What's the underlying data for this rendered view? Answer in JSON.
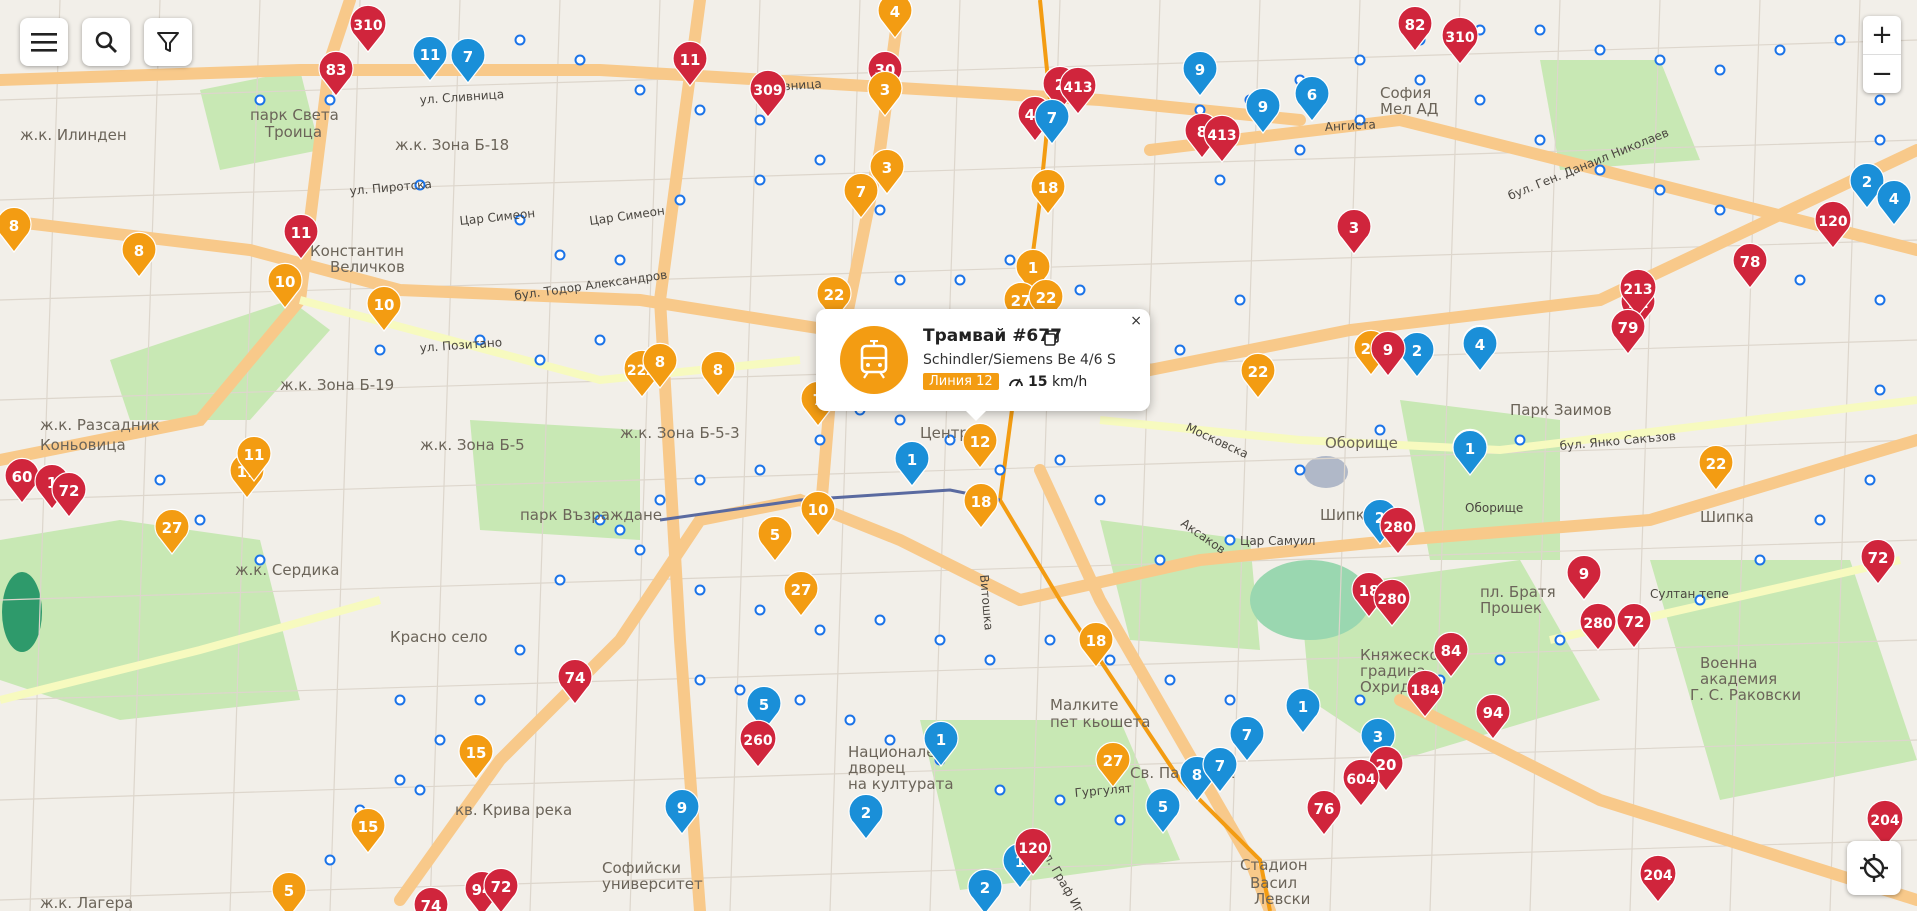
{
  "controls": {
    "menu_icon": "menu-icon",
    "search_icon": "search-icon",
    "filter_icon": "filter-icon",
    "zoom_in": "+",
    "zoom_out": "−",
    "locate_icon": "locate-icon"
  },
  "colors": {
    "tram": "#f39c12",
    "bus": "#d0253c",
    "trolley": "#1a8fd8",
    "stop": "#1a73e8"
  },
  "popup": {
    "title": "Трамвай #677",
    "model": "Schindler/Siemens Be 4/6 S",
    "line": "Линия 12",
    "speed_value": "15",
    "speed_unit": "km/h",
    "close": "×"
  },
  "place_labels": [
    "ж.к. Илинден",
    "ж.к. Зона Б-18",
    "ж.к. Зона Б-19",
    "ж.к. Разсадник",
    "Коньовица",
    "ж.к. Зона Б-5",
    "ж.к. Зона Б-5-3",
    "ж.к. Сердика",
    "кв. Крива река",
    "парк Света",
    "Троица",
    "парк Възраждане",
    "Центр",
    "Малките",
    "пет кьошета",
    "Княжеско",
    "градина",
    "Охридско",
    "пл. Братя",
    "Прошек",
    "Военна",
    "академия",
    "Г. С. Раковски",
    "Парк Заимов",
    "Константин",
    "Величков",
    "Стадион",
    "Васил",
    "Левски",
    "Софийски",
    "университет",
    "Национален",
    "дворец",
    "на културата",
    "Св. Патриарх",
    "ж.к. Лагера",
    "Красно село",
    "Oборище",
    "Шипка",
    "Шипка",
    "София",
    "Мел АД"
  ],
  "street_labels": [
    "бул. Тодор Александров",
    "бул. Янко Сакъзов",
    "бул. Ген. Данаил Николаев",
    "ул. Пиротска",
    "ул. Позитано",
    "Цар Симеон",
    "Цар Симеон",
    "ул. Сливница",
    "Сливница",
    "Ангиста",
    "Московска",
    "Аксаков",
    "Витошка",
    "ул. Граф Игнатиев",
    "Гургулят",
    "Оборище",
    "Султан тепе",
    "Цар Самуил"
  ],
  "markers": [
    {
      "t": "b",
      "l": "310"
    },
    {
      "t": "b",
      "l": "83"
    },
    {
      "t": "y",
      "l": "11"
    },
    {
      "t": "y",
      "l": "7"
    },
    {
      "t": "b",
      "l": "11"
    },
    {
      "t": "o",
      "l": "4"
    },
    {
      "t": "b",
      "l": "30"
    },
    {
      "t": "o",
      "l": "3"
    },
    {
      "t": "b",
      "l": "309"
    },
    {
      "t": "o",
      "l": "3"
    },
    {
      "t": "b",
      "l": "2"
    },
    {
      "t": "b",
      "l": "413"
    },
    {
      "t": "b",
      "l": "40"
    },
    {
      "t": "y",
      "l": "7"
    },
    {
      "t": "y",
      "l": "9"
    },
    {
      "t": "b",
      "l": "82"
    },
    {
      "t": "b",
      "l": "310"
    },
    {
      "t": "y",
      "l": "6"
    },
    {
      "t": "y",
      "l": "9"
    },
    {
      "t": "b",
      "l": "8"
    },
    {
      "t": "b",
      "l": "413"
    },
    {
      "t": "o",
      "l": "7"
    },
    {
      "t": "o",
      "l": "18"
    },
    {
      "t": "b",
      "l": "3"
    },
    {
      "t": "b",
      "l": "11"
    },
    {
      "t": "o",
      "l": "8"
    },
    {
      "t": "o",
      "l": "8"
    },
    {
      "t": "o",
      "l": "10"
    },
    {
      "t": "o",
      "l": "10"
    },
    {
      "t": "o",
      "l": "22"
    },
    {
      "t": "o",
      "l": "1"
    },
    {
      "t": "o",
      "l": "27"
    },
    {
      "t": "o",
      "l": "22"
    },
    {
      "t": "o",
      "l": "22A"
    },
    {
      "t": "o",
      "l": "8"
    },
    {
      "t": "o",
      "l": "8"
    },
    {
      "t": "o",
      "l": "7"
    },
    {
      "t": "o",
      "l": "22"
    },
    {
      "t": "o",
      "l": "22"
    },
    {
      "t": "y",
      "l": "2"
    },
    {
      "t": "b",
      "l": "9"
    },
    {
      "t": "y",
      "l": "4"
    },
    {
      "t": "y",
      "l": "4"
    },
    {
      "t": "o",
      "l": "22"
    },
    {
      "t": "y",
      "l": "1"
    },
    {
      "t": "o",
      "l": "22"
    },
    {
      "t": "b",
      "l": "11"
    },
    {
      "t": "b",
      "l": "213"
    },
    {
      "t": "b",
      "l": "79"
    },
    {
      "t": "b",
      "l": "78"
    },
    {
      "t": "b",
      "l": "120"
    },
    {
      "t": "y",
      "l": "2"
    },
    {
      "t": "y",
      "l": "4"
    },
    {
      "t": "o",
      "l": "11"
    },
    {
      "t": "o",
      "l": "11"
    },
    {
      "t": "b",
      "l": "60"
    },
    {
      "t": "b",
      "l": "1"
    },
    {
      "t": "b",
      "l": "72"
    },
    {
      "t": "o",
      "l": "27"
    },
    {
      "t": "o",
      "l": "5"
    },
    {
      "t": "o",
      "l": "12"
    },
    {
      "t": "o",
      "l": "18"
    },
    {
      "t": "o",
      "l": "10"
    },
    {
      "t": "o",
      "l": "5"
    },
    {
      "t": "o",
      "l": "27"
    },
    {
      "t": "y",
      "l": "2"
    },
    {
      "t": "b",
      "l": "280"
    },
    {
      "t": "b",
      "l": "18"
    },
    {
      "t": "b",
      "l": "280"
    },
    {
      "t": "b",
      "l": "9"
    },
    {
      "t": "b",
      "l": "280"
    },
    {
      "t": "b",
      "l": "72"
    },
    {
      "t": "b",
      "l": "72"
    },
    {
      "t": "o",
      "l": "18"
    },
    {
      "t": "b",
      "l": "74"
    },
    {
      "t": "o",
      "l": "15"
    },
    {
      "t": "o",
      "l": "15"
    },
    {
      "t": "o",
      "l": "5"
    },
    {
      "t": "y",
      "l": "5"
    },
    {
      "t": "b",
      "l": "260"
    },
    {
      "t": "y",
      "l": "1"
    },
    {
      "t": "y",
      "l": "9"
    },
    {
      "t": "y",
      "l": "2"
    },
    {
      "t": "y",
      "l": "1"
    },
    {
      "t": "o",
      "l": "27"
    },
    {
      "t": "y",
      "l": "8"
    },
    {
      "t": "y",
      "l": "7"
    },
    {
      "t": "y",
      "l": "5"
    },
    {
      "t": "y",
      "l": "7"
    },
    {
      "t": "y",
      "l": "1"
    },
    {
      "t": "b",
      "l": "84"
    },
    {
      "t": "b",
      "l": "184"
    },
    {
      "t": "b",
      "l": "94"
    },
    {
      "t": "y",
      "l": "3"
    },
    {
      "t": "b",
      "l": "20"
    },
    {
      "t": "b",
      "l": "604"
    },
    {
      "t": "b",
      "l": "76"
    },
    {
      "t": "b",
      "l": "204"
    },
    {
      "t": "b",
      "l": "204"
    },
    {
      "t": "b",
      "l": "120"
    },
    {
      "t": "y",
      "l": "2"
    },
    {
      "t": "b",
      "l": "94"
    },
    {
      "t": "b",
      "l": "72"
    },
    {
      "t": "b",
      "l": "74"
    },
    {
      "t": "y",
      "l": "1"
    },
    {
      "t": "o",
      "l": "5"
    }
  ]
}
